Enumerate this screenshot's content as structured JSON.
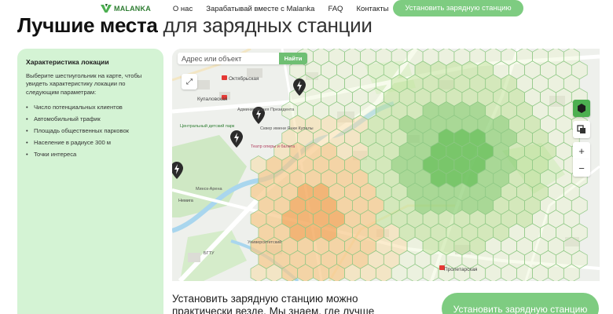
{
  "header": {
    "logo_text": "MALANKA",
    "nav": [
      {
        "label": "О нас"
      },
      {
        "label": "Зарабатывай вместе с Malanka"
      },
      {
        "label": "FAQ"
      },
      {
        "label": "Контакты"
      }
    ],
    "cta_label": "Установить зарядную станцию"
  },
  "title": {
    "bold": "Лучшие места",
    "light": "для зарядных станции"
  },
  "sidebar": {
    "title": "Характеристика локации",
    "description": "Выберите шестиугольник на карте, чтобы увидеть характеристику локации по следующим параметрам:",
    "items": [
      {
        "label": "Число потенциальных клиентов"
      },
      {
        "label": "Автомобильный трафик"
      },
      {
        "label": "Площадь общественных парковок"
      },
      {
        "label": "Население в радиусе 300 м"
      },
      {
        "label": "Точки интереса"
      }
    ]
  },
  "map": {
    "search_placeholder": "Адрес или объект",
    "find_label": "Найти",
    "labels": [
      {
        "text": "Октябрьская"
      },
      {
        "text": "Купаловская"
      },
      {
        "text": "Администрация Президента"
      },
      {
        "text": "Сквер имени Янки Купалы"
      },
      {
        "text": "Театр оперы и балета"
      },
      {
        "text": "Центральный детский парк"
      },
      {
        "text": "Пролетарская"
      },
      {
        "text": "Немига"
      },
      {
        "text": "Университетский"
      },
      {
        "text": "Минск-Арена"
      },
      {
        "text": "БГТУ"
      }
    ]
  },
  "bottom": {
    "text": "Установить зарядную станцию можно практически везде. Мы знаем, где лучше",
    "cta_label": "Установить зарядную станцию"
  },
  "colors": {
    "accent": "#7ecc81",
    "sidebar_bg": "#d4f3d4"
  }
}
